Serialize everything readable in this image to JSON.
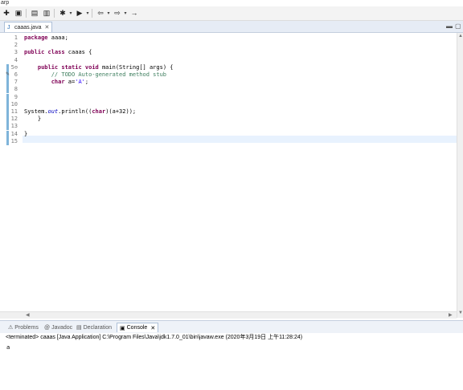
{
  "window": {
    "title": "arp"
  },
  "toolbar": {
    "buttons": [
      {
        "icon": "new-icon",
        "glyph": "✚"
      },
      {
        "icon": "save-icon",
        "glyph": "▣"
      },
      {
        "icon": "save-all-icon",
        "glyph": "▤"
      },
      {
        "icon": "print-icon",
        "glyph": "▥"
      },
      {
        "icon": "debug-icon",
        "glyph": "✱"
      },
      {
        "icon": "run-icon",
        "glyph": "▶"
      },
      {
        "icon": "back-icon",
        "glyph": "⇦"
      },
      {
        "icon": "forward-icon",
        "glyph": "⇨"
      },
      {
        "icon": "nav-icon",
        "glyph": "→"
      }
    ]
  },
  "editor": {
    "tab_label": "caaas.java",
    "lines": [
      {
        "n": "1",
        "html": "<span class=\"kw\">package</span> aaaa;"
      },
      {
        "n": "2",
        "html": ""
      },
      {
        "n": "3",
        "html": "<span class=\"kw\">public</span> <span class=\"kw\">class</span> caaas {"
      },
      {
        "n": "4",
        "html": ""
      },
      {
        "n": "5⊖",
        "html": "    <span class=\"kw\">public</span> <span class=\"kw\">static</span> <span class=\"kw\">void</span> main(String[] args) {"
      },
      {
        "n": "6",
        "html": "        <span class=\"cm\">// TODO Auto-generated method stub</span>"
      },
      {
        "n": "7",
        "html": "        <span class=\"kw\">char</span> a=<span class=\"str\">'A'</span>;"
      },
      {
        "n": "8",
        "html": ""
      },
      {
        "n": "9",
        "html": ""
      },
      {
        "n": "10",
        "html": ""
      },
      {
        "n": "11",
        "html": "System.<span class=\"fld\">out</span>.println((<span class=\"kw\">char</span>)(a+32));"
      },
      {
        "n": "12",
        "html": "    }"
      },
      {
        "n": "13",
        "html": ""
      },
      {
        "n": "14",
        "html": "}"
      },
      {
        "n": "15",
        "html": ""
      }
    ]
  },
  "panel": {
    "tabs": [
      {
        "label": "Problems",
        "icon": "problems-icon",
        "glyph": "⚠"
      },
      {
        "label": "Javadoc",
        "icon": "javadoc-icon",
        "glyph": "@"
      },
      {
        "label": "Declaration",
        "icon": "declaration-icon",
        "glyph": "▤"
      },
      {
        "label": "Console",
        "icon": "console-icon",
        "glyph": "▣",
        "active": true
      }
    ],
    "console_header": "<terminated> caaas [Java Application] C:\\Program Files\\Java\\jdk1.7.0_01\\bin\\javaw.exe (2020年3月19日 上午11:28:24)",
    "console_output": "a"
  }
}
